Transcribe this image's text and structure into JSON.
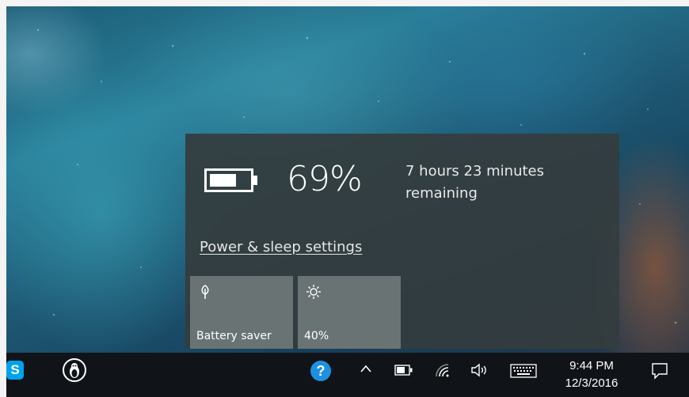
{
  "battery_flyout": {
    "percent": "69%",
    "charge_fraction": 0.69,
    "time_remaining": "7 hours 23 minutes remaining",
    "settings_link": "Power & sleep settings",
    "tiles": [
      {
        "label": "Battery saver",
        "icon": "leaf-icon"
      },
      {
        "label": "40%",
        "icon": "brightness-icon"
      }
    ]
  },
  "taskbar": {
    "apps": [
      {
        "name": "Skype",
        "icon": "skype-icon",
        "glyph": "S"
      },
      {
        "name": "Linux penguin app",
        "icon": "penguin-icon"
      }
    ],
    "tray": {
      "help_glyph": "?",
      "icons": [
        "help-icon",
        "chevron-up-icon",
        "battery-icon",
        "wifi-icon",
        "volume-icon",
        "keyboard-icon",
        "action-center-icon"
      ]
    },
    "clock": {
      "time": "9:44 PM",
      "date": "12/3/2016"
    }
  },
  "colors": {
    "flyout_bg": "#343c3e",
    "tile_bg": "#737d7d",
    "taskbar_bg": "#101418",
    "help_blue": "#1e90e0",
    "skype_blue": "#00a2ed"
  }
}
